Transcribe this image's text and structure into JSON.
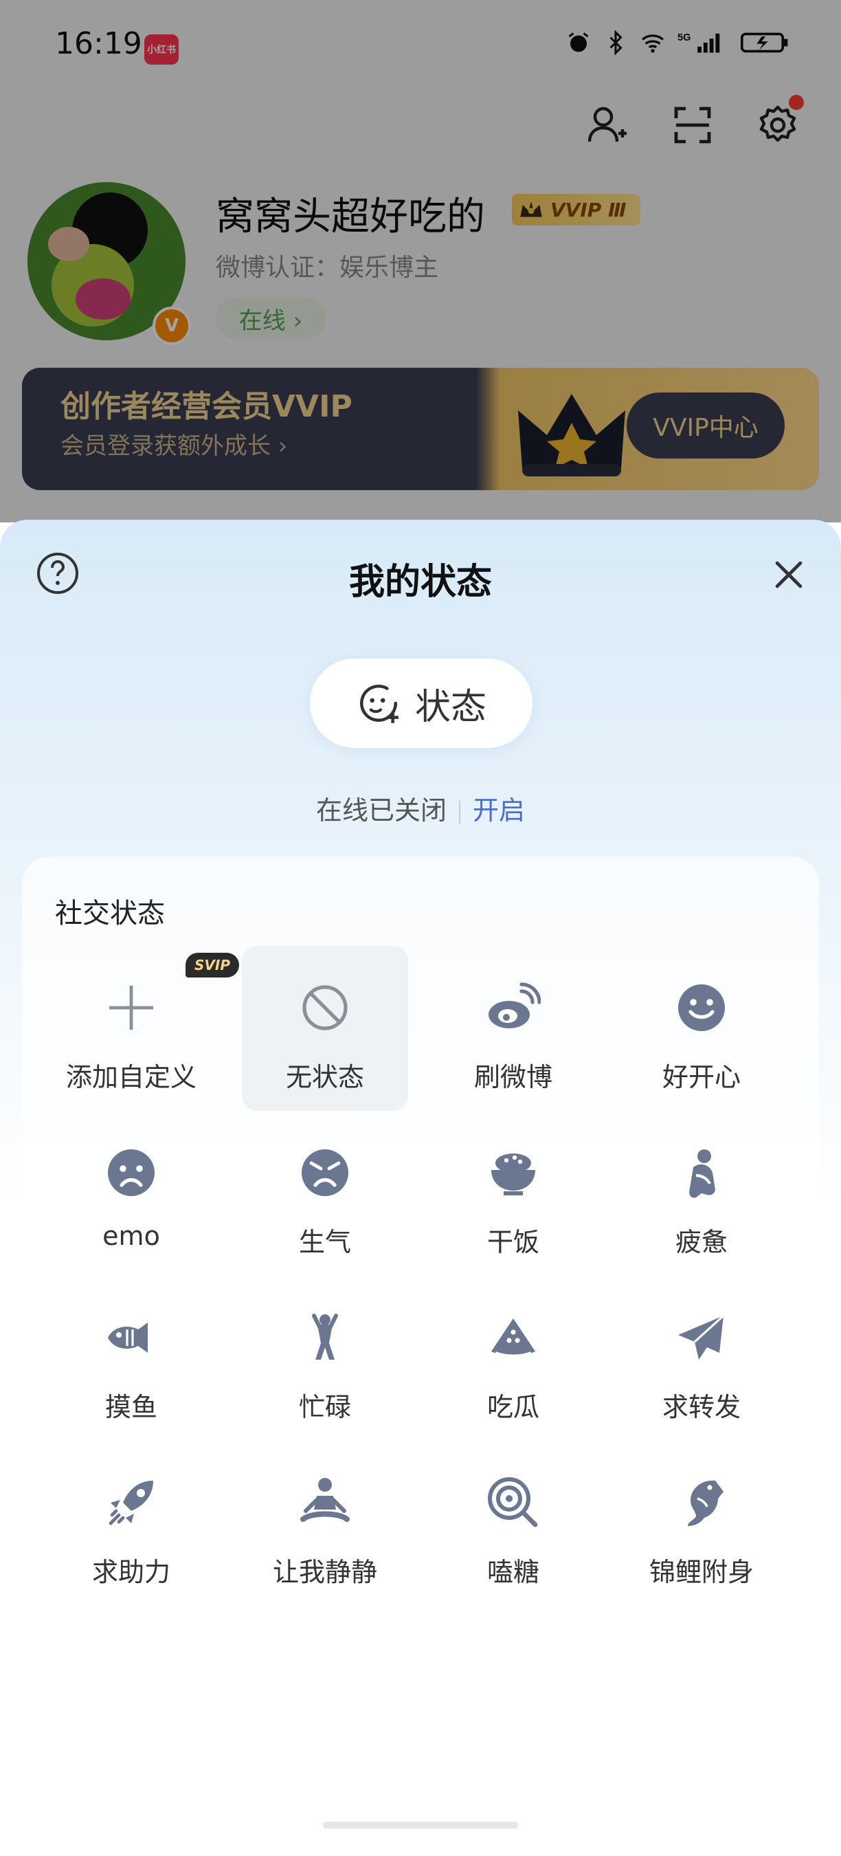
{
  "status_bar": {
    "time": "16:19",
    "app_badge": "小红书",
    "network": "5G"
  },
  "profile": {
    "name": "窝窝头超好吃的",
    "vip_label": "VVIP Ⅲ",
    "verification": "微博认证：娱乐博主",
    "online_label": "在线 ›"
  },
  "banner": {
    "title": "创作者经营会员VVIP",
    "subtitle": "会员登录获额外成长 ›",
    "cta": "VVIP中心"
  },
  "sheet": {
    "title": "我的状态",
    "status_button": "状态",
    "online_closed": "在线已关闭",
    "open_link": "开启",
    "section_title": "社交状态",
    "items": [
      {
        "label": "添加自定义",
        "icon": "plus-icon",
        "badge": "SVIP"
      },
      {
        "label": "无状态",
        "icon": "ban-icon"
      },
      {
        "label": "刷微博",
        "icon": "weibo-icon"
      },
      {
        "label": "好开心",
        "icon": "happy-icon"
      },
      {
        "label": "emo",
        "icon": "sad-icon"
      },
      {
        "label": "生气",
        "icon": "angry-icon"
      },
      {
        "label": "干饭",
        "icon": "rice-bowl-icon"
      },
      {
        "label": "疲惫",
        "icon": "tired-icon"
      },
      {
        "label": "摸鱼",
        "icon": "fish-icon"
      },
      {
        "label": "忙碌",
        "icon": "busy-icon"
      },
      {
        "label": "吃瓜",
        "icon": "watermelon-icon"
      },
      {
        "label": "求转发",
        "icon": "paper-plane-icon"
      },
      {
        "label": "求助力",
        "icon": "rocket-icon"
      },
      {
        "label": "让我静静",
        "icon": "meditate-icon"
      },
      {
        "label": "嗑糖",
        "icon": "lollipop-icon"
      },
      {
        "label": "锦鲤附身",
        "icon": "koi-icon"
      }
    ]
  },
  "colors": {
    "icon": "#6b7690",
    "accent": "#4a6bd0",
    "online_green": "#5aa055",
    "vip_gold": "#f6d594"
  }
}
